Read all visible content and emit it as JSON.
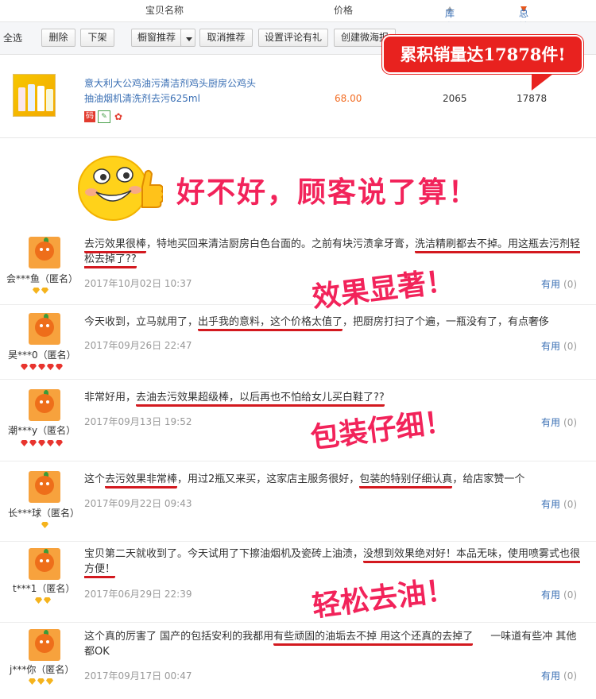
{
  "header": {
    "name_col": "宝贝名称",
    "price_col": "价格",
    "stock_col": "库存",
    "sales_col": "总销量"
  },
  "toolbar": {
    "select_all": "全选",
    "delete": "删除",
    "unlist": "下架",
    "window_recommend": "橱窗推荐",
    "cancel_recommend": "取消推荐",
    "set_review_gift": "设置评论有礼",
    "create_weitao": "创建微海报"
  },
  "product": {
    "title": "意大利大公鸡油污清洁剂鸡头厨房公鸡头抽油烟机清洗剂去污625ml",
    "price": "68.00",
    "stock": "2065",
    "sales": "17878",
    "badge": "累积销量达17878件!"
  },
  "banner": {
    "text": "好不好，顾客说了算！"
  },
  "stamps": {
    "s1": "效果显著！",
    "s2": "包装仔细！",
    "s3": "轻松去油！"
  },
  "reviews": [
    {
      "nick": "会***鱼（匿名）",
      "p1": "去污效果很棒",
      "p2": "，特地买回来清洁厨房白色台面的。之前有块污渍拿牙膏，",
      "p3": "洗洁精刷都去不掉。用这瓶去污剂轻松去掉了??",
      "date": "2017年10月02日 10:37",
      "useful": "有用",
      "count": "(0)"
    },
    {
      "nick": "昊***0（匿名）",
      "p1": "今天收到，立马就用了，",
      "p2": "出乎我的意料，这个价格太值了",
      "p3": "，把厨房打扫了个遍，一瓶没有了，有点奢侈",
      "date": "2017年09月26日 22:47",
      "useful": "有用",
      "count": "(0)"
    },
    {
      "nick": "潮***y（匿名）",
      "p1": "非常好用，",
      "p2": "去油去污效果超级棒，以后再也不怕给女儿买白鞋了??",
      "date": "2017年09月13日 19:52",
      "useful": "有用",
      "count": "(0)"
    },
    {
      "nick": "长***球（匿名）",
      "p1": "这个",
      "p2": "去污效果非常棒",
      "p3": "，用过2瓶又来买，这家店主服务很好，",
      "p4": "包装的特别仔细认真",
      "p5": "，给店家赞一个",
      "date": "2017年09月22日 09:43",
      "useful": "有用",
      "count": "(0)"
    },
    {
      "nick": "t***1（匿名）",
      "p1": "宝贝第二天就收到了。今天试用了下擦油烟机及瓷砖上油渍，",
      "p2": "没想到效果绝对好！本品无味，使用喷雾式也很方便！",
      "date": "2017年06月29日 22:39",
      "useful": "有用",
      "count": "(0)"
    },
    {
      "nick": "j***你（匿名）",
      "p1": "这个真的厉害了 国产的包括安利的我都用",
      "p2": "有些顽固的油垢去不掉 用这个还真的去掉了",
      "p3": "一味道有些冲 其他都OK",
      "date": "2017年09月17日 00:47",
      "useful": "有用",
      "count": "(0)"
    }
  ],
  "colors": {
    "accent_red": "#f2235a",
    "link_blue": "#3a6fb4",
    "price_orange": "#f26c22",
    "underline_red": "#d3191f"
  },
  "icons": [
    "arrow-up-icon",
    "arrow-down-icon",
    "dropdown-arrow-icon",
    "thumbs-up-emoji",
    "avatar-icon",
    "gem-icon"
  ]
}
